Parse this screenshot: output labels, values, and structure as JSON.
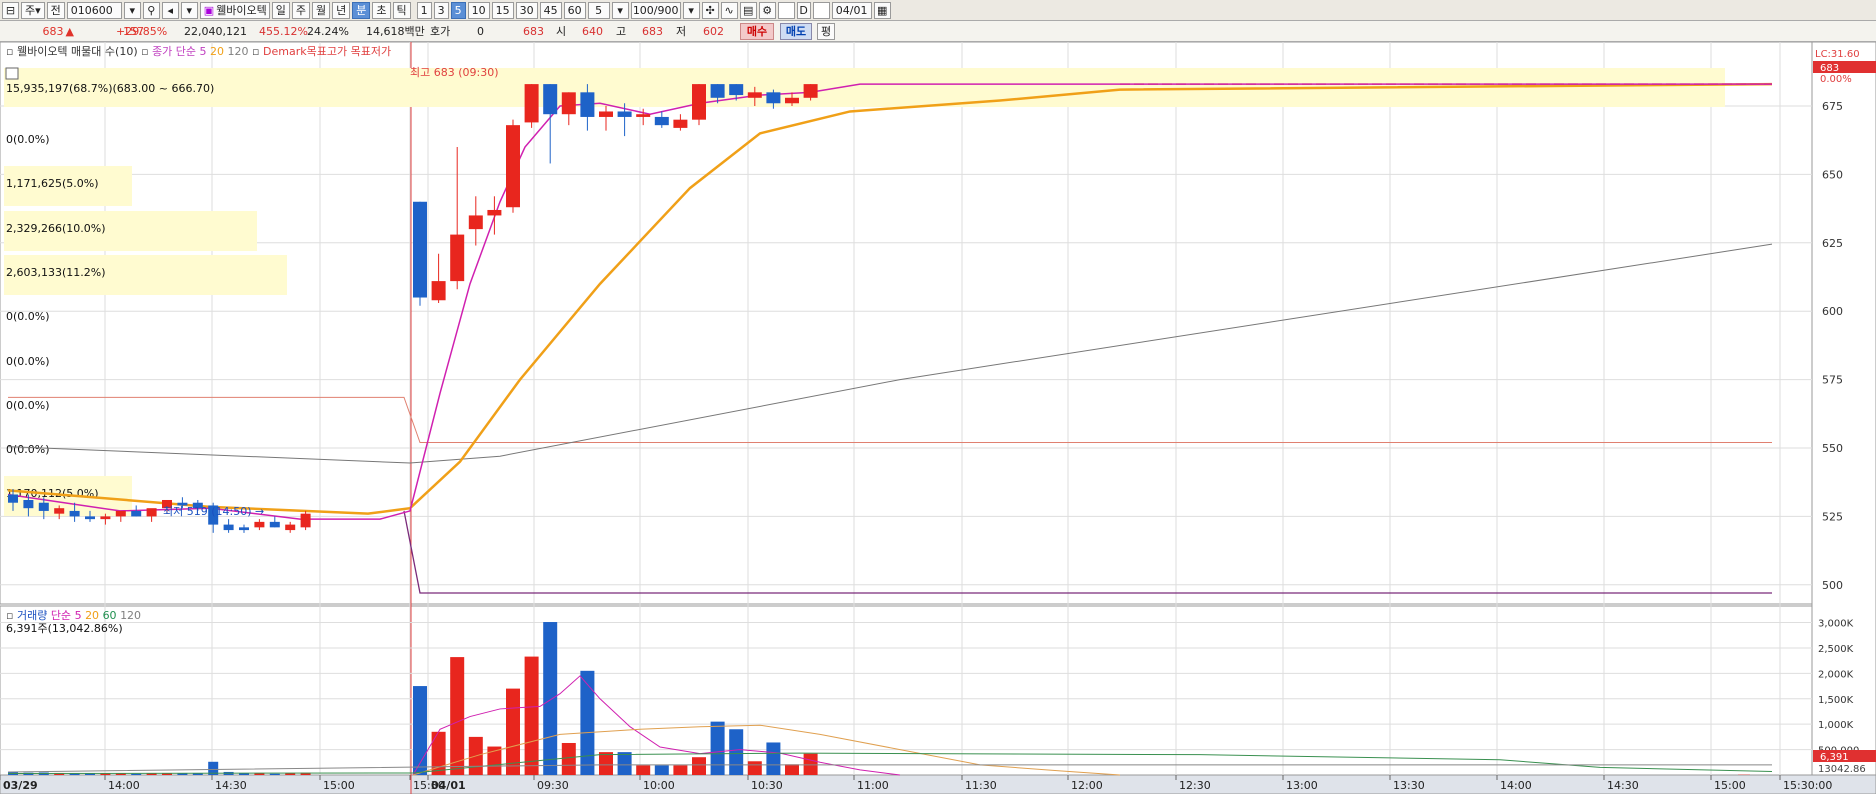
{
  "toolbar": {
    "market": "주",
    "scope": "전",
    "code": "010600",
    "stock_name": "웰바이오텍",
    "periods": [
      "일",
      "주",
      "월",
      "년",
      "분",
      "초",
      "틱"
    ],
    "active_period": "분",
    "intervals": [
      "1",
      "3",
      "5",
      "10",
      "15",
      "30",
      "45",
      "60"
    ],
    "active_interval": "5",
    "interval_select": "5",
    "count": "100/900",
    "date": "04/01"
  },
  "quote": {
    "price": "683",
    "arrow": "▲",
    "change": "157",
    "change_pct": "+29.85%",
    "volume": "22,040,121",
    "volume_pct": "455.12%",
    "turnover": "24.24%",
    "amount": "14,618백만",
    "hoga_label": "호가",
    "hoga_value": "0",
    "hoga_price": "683",
    "open_label": "시",
    "open": "640",
    "high_label": "고",
    "high": "683",
    "low_label": "저",
    "low": "602",
    "buy": "매수",
    "sell": "매도",
    "eval": "평"
  },
  "price_panel": {
    "legend": {
      "vp": "웰바이오텍 매물대 수(10)",
      "ma_title": "종가 단순",
      "ma5": "5",
      "ma20": "20",
      "ma120": "120",
      "demark": "Demark목표고가",
      "demark_low": "목표저가"
    },
    "top_band": "15,935,197(68.7%)(683.00 ~ 666.70)",
    "vp_labels": [
      "0(0.0%)",
      "1,171,625(5.0%)",
      "2,329,266(10.0%)",
      "2,603,133(11.2%)",
      "0(0.0%)",
      "0(0.0%)",
      "0(0.0%)",
      "0(0.0%)",
      "1,170,112(5.0%)"
    ],
    "max_annot": "최고 683 (09:30)",
    "min_annot": "최저 519 (14:50)",
    "yticks": [
      "675",
      "650",
      "625",
      "600",
      "575",
      "550",
      "525",
      "500"
    ],
    "axis_top_lc": "LC:31.60",
    "axis_top_price": "683",
    "axis_top_pct": "0.00%"
  },
  "volume_panel": {
    "legend": {
      "title": "거래량",
      "ma": "단순",
      "ma5": "5",
      "ma20": "20",
      "ma60": "60",
      "ma120": "120"
    },
    "value_label": "6,391주(13,042.86%)",
    "yticks": [
      "3,000K",
      "2,500K",
      "2,000K",
      "1,500K",
      "1,000K",
      "500,000"
    ],
    "last_value": "6,391",
    "last_pct": "13042.86"
  },
  "xaxis": [
    {
      "label": "03/29",
      "bold": true
    },
    {
      "label": "14:00"
    },
    {
      "label": "14:30"
    },
    {
      "label": "15:00"
    },
    {
      "label": "15:30"
    },
    {
      "label": "04/01",
      "bold": true
    },
    {
      "label": "09:30"
    },
    {
      "label": "10:00"
    },
    {
      "label": "10:30"
    },
    {
      "label": "11:00"
    },
    {
      "label": "11:30"
    },
    {
      "label": "12:00"
    },
    {
      "label": "12:30"
    },
    {
      "label": "13:00"
    },
    {
      "label": "13:30"
    },
    {
      "label": "14:00"
    },
    {
      "label": "14:30"
    },
    {
      "label": "15:00"
    },
    {
      "label": "15:30:00"
    }
  ],
  "colors": {
    "up": "#e8261e",
    "down": "#1e62c8",
    "ma5": "#d020b0",
    "ma20": "#f0a018",
    "ma120": "#808080",
    "band": "#fffbd0",
    "grid": "#dedede"
  },
  "chart_data": {
    "type": "candlestick",
    "ylim": [
      490,
      685
    ],
    "candles": [
      {
        "t": "03/29 13:35",
        "o": 533,
        "h": 535,
        "l": 527,
        "c": 530
      },
      {
        "t": "13:40",
        "o": 531,
        "h": 533,
        "l": 525,
        "c": 528
      },
      {
        "t": "13:45",
        "o": 530,
        "h": 532,
        "l": 524,
        "c": 527
      },
      {
        "t": "13:50",
        "o": 526,
        "h": 529,
        "l": 524,
        "c": 528
      },
      {
        "t": "13:55",
        "o": 527,
        "h": 530,
        "l": 523,
        "c": 525
      },
      {
        "t": "14:00",
        "o": 525,
        "h": 527,
        "l": 523,
        "c": 524
      },
      {
        "t": "14:05",
        "o": 524,
        "h": 526,
        "l": 522,
        "c": 525
      },
      {
        "t": "14:10",
        "o": 525,
        "h": 527,
        "l": 523,
        "c": 527
      },
      {
        "t": "14:15",
        "o": 527,
        "h": 529,
        "l": 525,
        "c": 525
      },
      {
        "t": "14:20",
        "o": 525,
        "h": 527,
        "l": 523,
        "c": 528
      },
      {
        "t": "14:25",
        "o": 528,
        "h": 531,
        "l": 526,
        "c": 531
      },
      {
        "t": "14:30",
        "o": 530,
        "h": 532,
        "l": 528,
        "c": 529
      },
      {
        "t": "14:35",
        "o": 530,
        "h": 531,
        "l": 527,
        "c": 528
      },
      {
        "t": "14:40",
        "o": 529,
        "h": 530,
        "l": 519,
        "c": 522
      },
      {
        "t": "14:45",
        "o": 522,
        "h": 524,
        "l": 519,
        "c": 520
      },
      {
        "t": "14:50",
        "o": 521,
        "h": 522,
        "l": 519,
        "c": 520
      },
      {
        "t": "14:55",
        "o": 521,
        "h": 524,
        "l": 520,
        "c": 523
      },
      {
        "t": "15:00",
        "o": 523,
        "h": 525,
        "l": 521,
        "c": 521
      },
      {
        "t": "15:05",
        "o": 520,
        "h": 523,
        "l": 519,
        "c": 522
      },
      {
        "t": "15:10",
        "o": 521,
        "h": 527,
        "l": 520,
        "c": 526
      },
      {
        "t": "04/01 09:00",
        "o": 640,
        "h": 640,
        "l": 602,
        "c": 605
      },
      {
        "t": "09:05",
        "o": 604,
        "h": 621,
        "l": 603,
        "c": 611
      },
      {
        "t": "09:10",
        "o": 611,
        "h": 660,
        "l": 608,
        "c": 628
      },
      {
        "t": "09:15",
        "o": 630,
        "h": 642,
        "l": 624,
        "c": 635
      },
      {
        "t": "09:20",
        "o": 635,
        "h": 642,
        "l": 628,
        "c": 637
      },
      {
        "t": "09:25",
        "o": 638,
        "h": 670,
        "l": 636,
        "c": 668
      },
      {
        "t": "09:30",
        "o": 669,
        "h": 683,
        "l": 667,
        "c": 683
      },
      {
        "t": "09:35",
        "o": 683,
        "h": 683,
        "l": 654,
        "c": 672
      },
      {
        "t": "09:40",
        "o": 672,
        "h": 680,
        "l": 668,
        "c": 680
      },
      {
        "t": "09:45",
        "o": 680,
        "h": 683,
        "l": 666,
        "c": 671
      },
      {
        "t": "09:50",
        "o": 671,
        "h": 675,
        "l": 666,
        "c": 673
      },
      {
        "t": "09:55",
        "o": 673,
        "h": 676,
        "l": 664,
        "c": 671
      },
      {
        "t": "10:00",
        "o": 671,
        "h": 674,
        "l": 668,
        "c": 672
      },
      {
        "t": "10:05",
        "o": 671,
        "h": 673,
        "l": 667,
        "c": 668
      },
      {
        "t": "10:10",
        "o": 667,
        "h": 672,
        "l": 666,
        "c": 670
      },
      {
        "t": "10:15",
        "o": 670,
        "h": 683,
        "l": 668,
        "c": 683
      },
      {
        "t": "10:20",
        "o": 683,
        "h": 683,
        "l": 676,
        "c": 678
      },
      {
        "t": "10:25",
        "o": 683,
        "h": 683,
        "l": 677,
        "c": 679
      },
      {
        "t": "10:30",
        "o": 678,
        "h": 682,
        "l": 675,
        "c": 680
      },
      {
        "t": "10:35",
        "o": 680,
        "h": 681,
        "l": 674,
        "c": 676
      },
      {
        "t": "10:40",
        "o": 676,
        "h": 680,
        "l": 675,
        "c": 678
      },
      {
        "t": "10:45",
        "o": 678,
        "h": 683,
        "l": 677,
        "c": 683
      }
    ],
    "volume": [
      60,
      45,
      50,
      40,
      35,
      30,
      35,
      30,
      25,
      30,
      35,
      30,
      30,
      260,
      60,
      30,
      40,
      25,
      30,
      45,
      1750,
      850,
      2320,
      750,
      560,
      1700,
      2330,
      3010,
      630,
      2050,
      450,
      450,
      190,
      190,
      190,
      350,
      1050,
      900,
      270,
      640,
      210,
      420,
      0,
      0,
      0,
      0,
      0,
      0,
      0,
      0,
      0,
      0,
      0,
      0,
      0,
      0,
      0,
      0,
      0,
      0,
      0,
      0,
      0,
      0,
      0,
      0,
      0,
      0,
      0,
      0,
      0,
      0,
      0,
      0,
      0,
      0,
      0,
      0,
      0,
      0,
      0,
      0,
      0,
      0,
      0,
      0,
      0,
      0,
      0,
      0,
      0,
      0,
      0,
      0,
      0,
      0,
      0,
      0,
      0,
      0,
      0,
      0,
      0,
      0,
      6
    ]
  }
}
